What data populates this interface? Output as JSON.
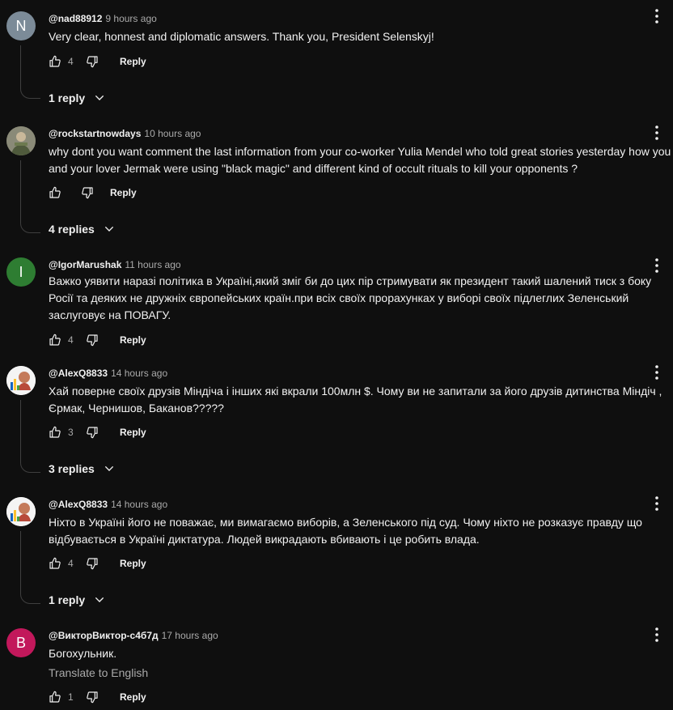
{
  "comments": [
    {
      "initial": "N",
      "avatar_color": "#7c8b98",
      "author": "@nad88912",
      "time": "9 hours ago",
      "text": "Very clear, honnest and diplomatic answers. Thank you, President Selenskyj!",
      "likes": "4",
      "reply_label": "Reply",
      "replies_label": "1 reply"
    },
    {
      "initial": "",
      "avatar_color": "#6b6a55",
      "author": "@rockstartnowdays",
      "time": "10 hours ago",
      "text": "why dont you want comment the last information from your co-worker Yulia Mendel who told great stories yesterday how you and your lover Jermak were using \"black magic\" and different kind of occult rituals to kill your opponents ?",
      "likes": "",
      "reply_label": "Reply",
      "replies_label": "4 replies"
    },
    {
      "initial": "I",
      "avatar_color": "#2e7d32",
      "author": "@IgorMarushak",
      "time": "11 hours ago",
      "text": "Важко уявити наразі політика в Україні,який зміг би до цих пір стримувати як президент такий шалений тиск з боку Росії та деяких не дружніх європейських країн.при всіх своїх прорахунках у виборі своїх підлеглих Зеленський заслуговує на ПОВАГУ.",
      "likes": "4",
      "reply_label": "Reply"
    },
    {
      "initial": "",
      "avatar_color": "#ffffff",
      "author": "@AlexQ8833",
      "time": "14 hours ago",
      "text": "Хай поверне своїх друзів Міндіча і інших які вкрали 100млн $. Чому ви не запитали за його друзів дитинства Міндіч , Єрмак, Чернишов, Баканов?????",
      "likes": "3",
      "reply_label": "Reply",
      "replies_label": "3 replies"
    },
    {
      "initial": "",
      "avatar_color": "#ffffff",
      "author": "@AlexQ8833",
      "time": "14 hours ago",
      "text": "Ніхто в Україні його не поважає, ми вимагаємо виборів, а Зеленського під суд. Чому ніхто не розказує правду що відбувається в Україні диктатура. Людей викрадають вбивають і це робить влада.",
      "likes": "4",
      "reply_label": "Reply",
      "replies_label": "1 reply"
    },
    {
      "initial": "B",
      "avatar_color": "#c2185b",
      "author": "@ВикторВиктор-с4б7д",
      "time": "17 hours ago",
      "text": "Богохульник.",
      "translate_label": "Translate to English",
      "likes": "1",
      "reply_label": "Reply"
    }
  ]
}
